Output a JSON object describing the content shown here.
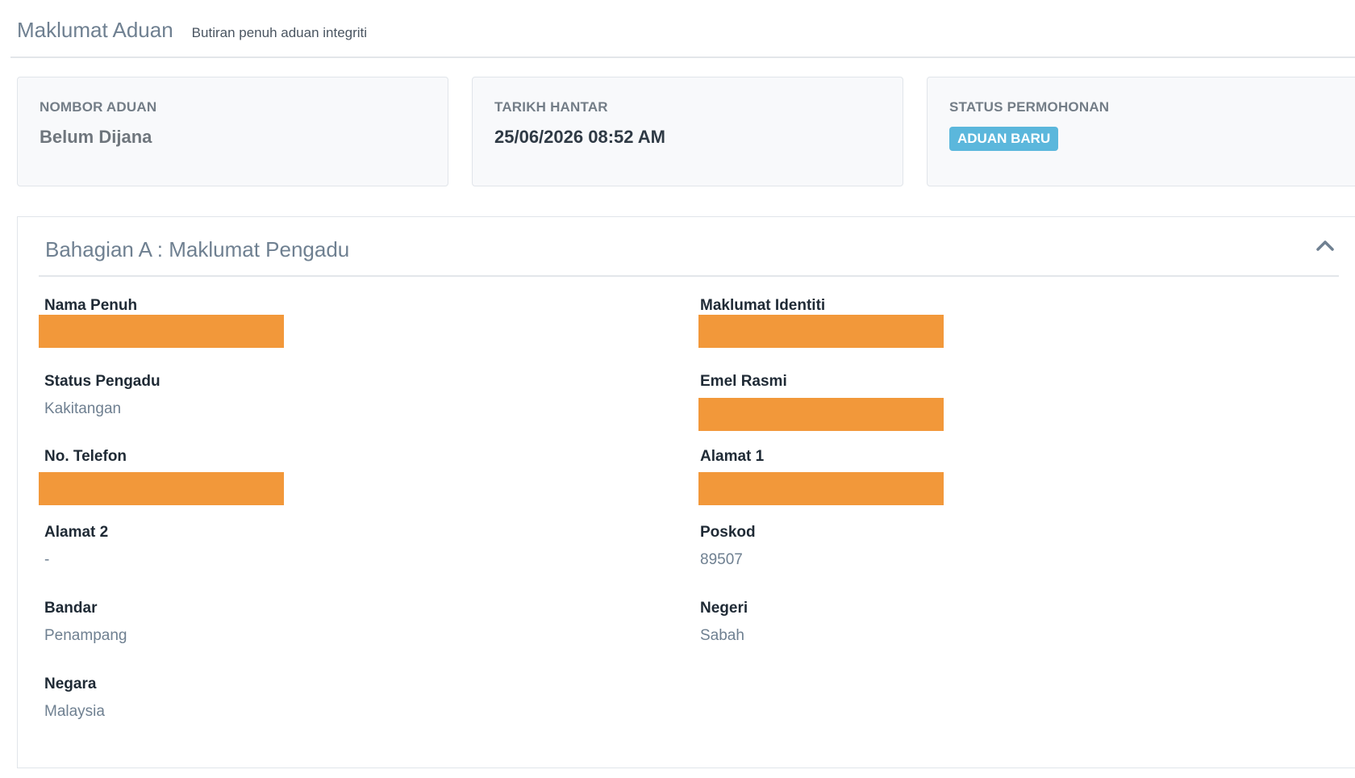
{
  "header": {
    "title": "Maklumat Aduan",
    "subtitle": "Butiran penuh aduan integriti"
  },
  "summary": {
    "complaint_number": {
      "label": "NOMBOR ADUAN",
      "value": "Belum Dijana"
    },
    "submit_date": {
      "label": "TARIKH HANTAR",
      "value": "25/06/2026 08:52 AM"
    },
    "status": {
      "label": "STATUS PERMOHONAN",
      "value": "ADUAN BARU",
      "color": "#5bb7dc"
    }
  },
  "section_a": {
    "title": "Bahagian A : Maklumat Pengadu",
    "toggle_icon": "chevron-up-icon",
    "fields": {
      "full_name": {
        "label": "Nama Penuh",
        "redacted": true
      },
      "identity": {
        "label": "Maklumat Identiti",
        "redacted": true
      },
      "complainant_status": {
        "label": "Status Pengadu",
        "value": "Kakitangan"
      },
      "official_email": {
        "label": "Emel Rasmi",
        "redacted": true
      },
      "phone": {
        "label": "No. Telefon",
        "redacted": true
      },
      "address_1": {
        "label": "Alamat 1",
        "redacted": true
      },
      "address_2": {
        "label": "Alamat 2",
        "value": "-"
      },
      "postcode": {
        "label": "Poskod",
        "value": "89507"
      },
      "city": {
        "label": "Bandar",
        "value": "Penampang"
      },
      "state": {
        "label": "Negeri",
        "value": "Sabah"
      },
      "country": {
        "label": "Negara",
        "value": "Malaysia"
      }
    }
  },
  "colors": {
    "redaction": "#f2983a",
    "heading": "#6f8091"
  }
}
